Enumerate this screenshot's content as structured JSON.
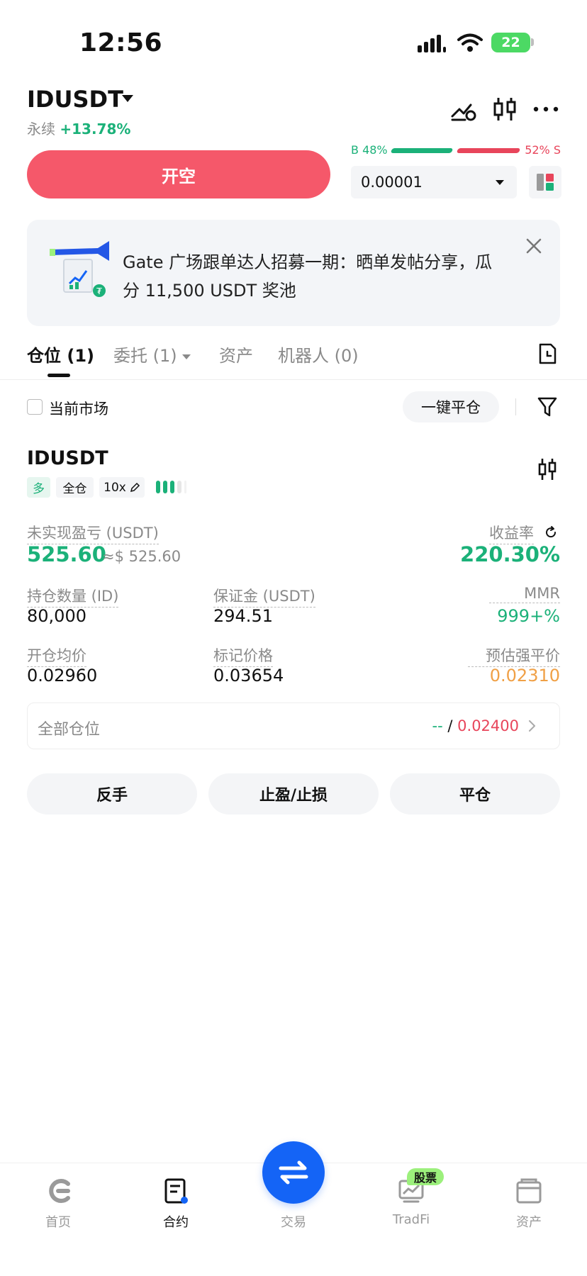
{
  "status": {
    "time": "12:56",
    "battery": "22"
  },
  "header": {
    "pair": "IDUSDT",
    "contract_type": "永续",
    "change": "+13.78%",
    "short_button": "开空",
    "buy_ratio": "B 48%",
    "sell_ratio": "52% S",
    "price_step": "0.00001",
    "icons": [
      "price-alert-icon",
      "candlestick-icon",
      "more-icon"
    ]
  },
  "banner": {
    "text": "Gate 广场跟单达人招募一期：晒单发帖分享，瓜分 11,500 USDT 奖池"
  },
  "tabs": [
    {
      "label": "仓位",
      "count": "(1)"
    },
    {
      "label": "委托",
      "count": "(1)"
    },
    {
      "label": "资产",
      "count": ""
    },
    {
      "label": "机器人",
      "count": "(0)"
    }
  ],
  "filter": {
    "current_market": "当前市场",
    "close_all": "一键平仓"
  },
  "position": {
    "symbol": "IDUSDT",
    "side": "多",
    "margin_mode": "全仓",
    "leverage": "10x",
    "risk_level": 3,
    "unrealized_pnl_label": "未实现盈亏 (USDT)",
    "unrealized_pnl": "525.60",
    "unrealized_pnl_usd": "≈$ 525.60",
    "roe_label": "收益率",
    "roe": "220.30%",
    "size_label": "持仓数量 (ID)",
    "size": "80,000",
    "margin_label": "保证金 (USDT)",
    "margin": "294.51",
    "mmr_label": "MMR",
    "mmr": "999+%",
    "entry_label": "开仓均价",
    "entry": "0.02960",
    "mark_label": "标记价格",
    "mark": "0.03654",
    "liq_label": "预估强平价",
    "liq": "0.02310",
    "all_positions_label": "全部仓位",
    "tp_value": "--",
    "sl_value": "0.02400",
    "actions": [
      "反手",
      "止盈/止损",
      "平仓"
    ]
  },
  "nav": {
    "items": [
      "首页",
      "合约",
      "交易",
      "TradFi",
      "资产"
    ],
    "badge": "股票",
    "active": "合约"
  },
  "colors": {
    "green": "#1bb179",
    "red": "#e8455b",
    "orange": "#f0a046",
    "blue": "#1464f6"
  }
}
